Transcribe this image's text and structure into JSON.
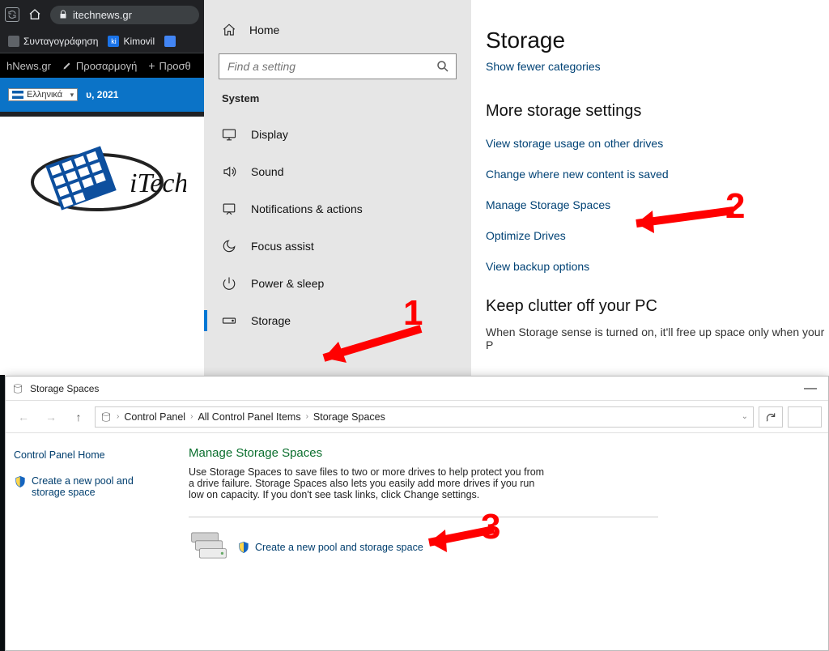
{
  "browser": {
    "url": "itechnews.gr",
    "bookmarks": [
      {
        "label": "Συνταγογράφηση",
        "icon_bg": "#5f6368"
      },
      {
        "label": "Kimovil",
        "icon_bg": "#1a73e8"
      },
      {
        "label": "",
        "icon_bg": "#4285f4"
      }
    ],
    "tabs": [
      {
        "label": "hNews.gr"
      },
      {
        "label": "Προσαρμογή"
      },
      {
        "label": "Προσθ"
      }
    ],
    "lang_label": "Ελληνικά",
    "date_text": "υ, 2021",
    "logo_text": "iTech"
  },
  "settings": {
    "home": "Home",
    "search_placeholder": "Find a setting",
    "group": "System",
    "nav": [
      {
        "label": "Display",
        "icon": "display"
      },
      {
        "label": "Sound",
        "icon": "sound"
      },
      {
        "label": "Notifications & actions",
        "icon": "notifications"
      },
      {
        "label": "Focus assist",
        "icon": "focus"
      },
      {
        "label": "Power & sleep",
        "icon": "power"
      },
      {
        "label": "Storage",
        "icon": "storage",
        "selected": true
      }
    ],
    "main": {
      "title": "Storage",
      "show_fewer": "Show fewer categories",
      "more_heading": "More storage settings",
      "links": [
        "View storage usage on other drives",
        "Change where new content is saved",
        "Manage Storage Spaces",
        "Optimize Drives",
        "View backup options"
      ],
      "clutter_heading": "Keep clutter off your PC",
      "clutter_desc": "When Storage sense is turned on, it'll free up space only when your P"
    }
  },
  "cp": {
    "title": "Storage Spaces",
    "breadcrumbs": [
      "Control Panel",
      "All Control Panel Items",
      "Storage Spaces"
    ],
    "left_home": "Control Panel Home",
    "left_link": "Create a new pool and storage space",
    "main_title": "Manage Storage Spaces",
    "desc": "Use Storage Spaces to save files to two or more drives to help protect you from a drive failure. Storage Spaces also lets you easily add more drives if you run low on capacity. If you don't see task links, click Change settings.",
    "action_link": "Create a new pool and storage space"
  },
  "annotations": {
    "n1": "1",
    "n2": "2",
    "n3": "3"
  }
}
